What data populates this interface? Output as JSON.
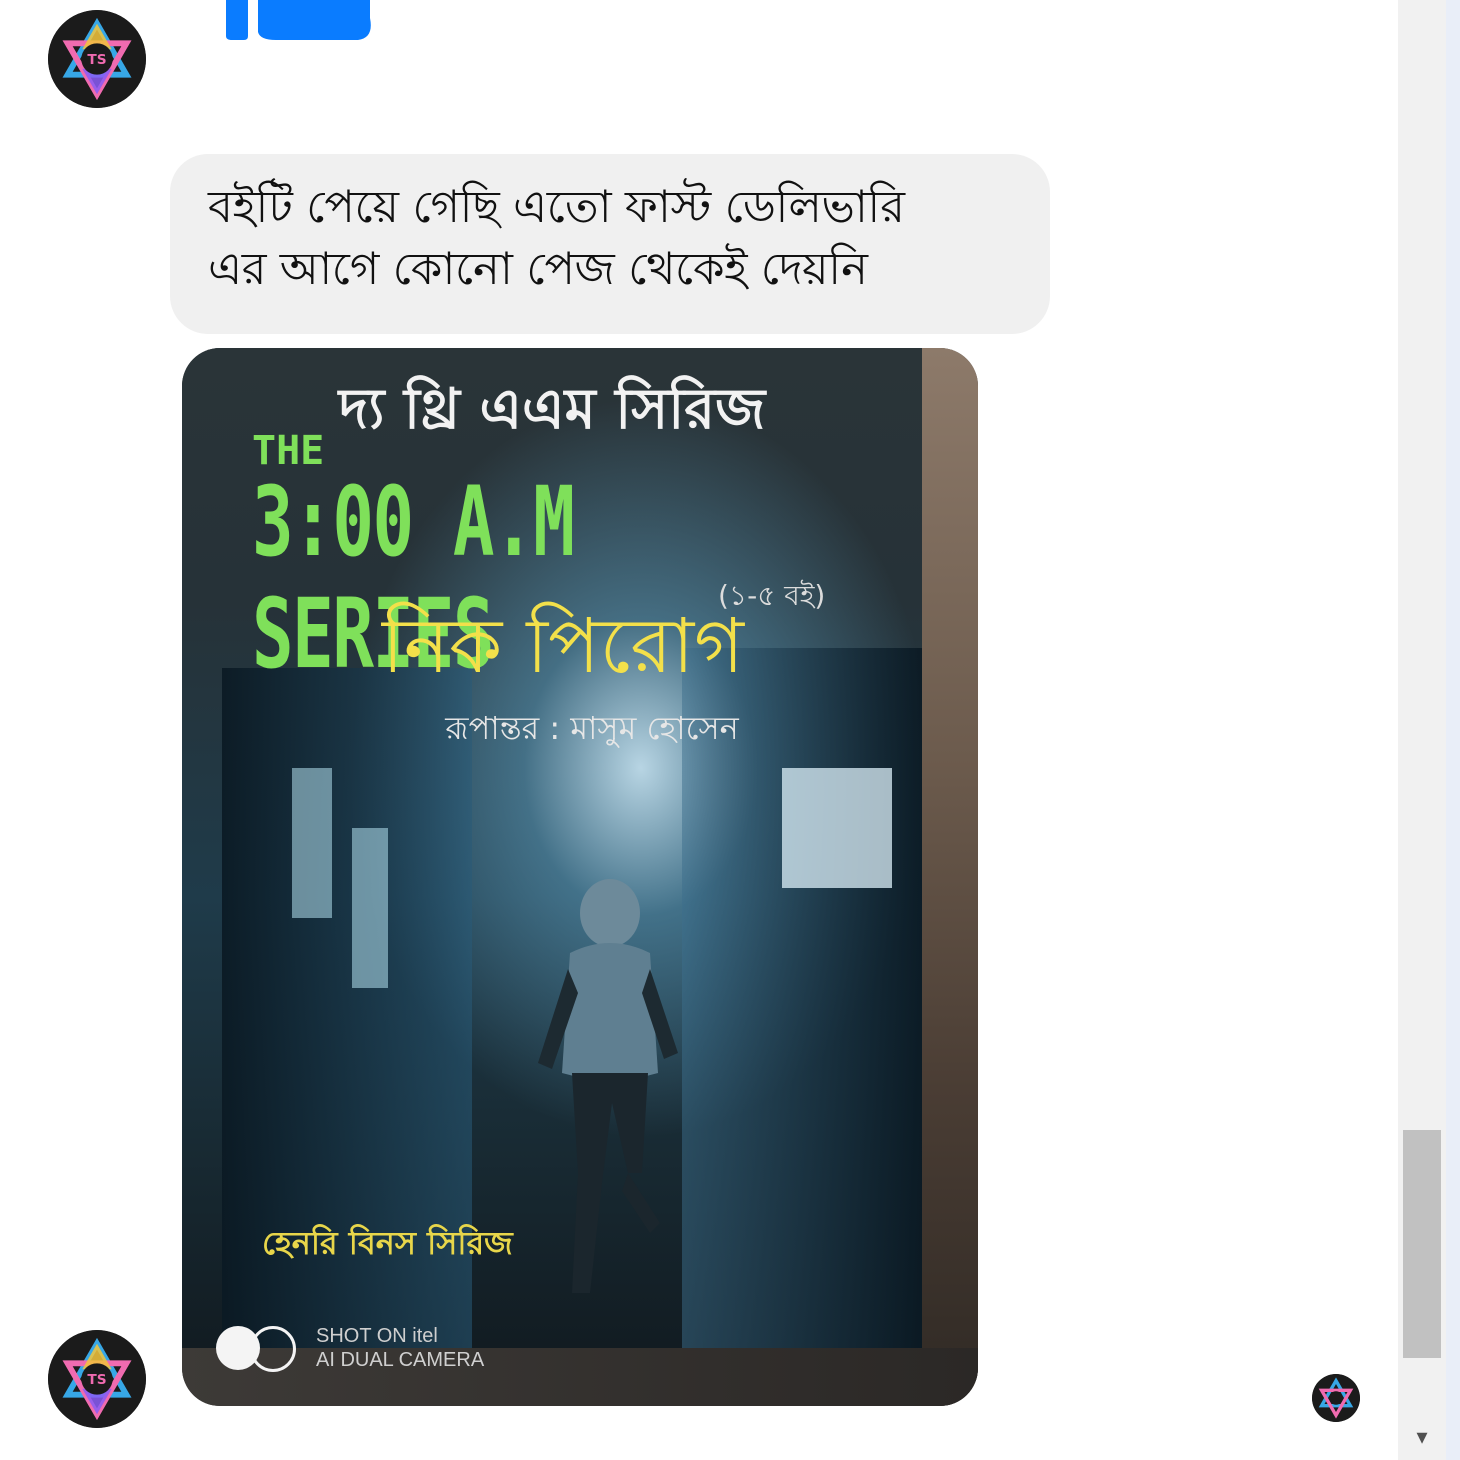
{
  "conversation": {
    "message_text": "বইটি পেয়ে গেছি এতো ফাস্ট ডেলিভারি এর আগে কোনো পেজ থেকেই দেয়নি",
    "message_lines": [
      "বইটি পেয়ে গেছি এতো ফাস্ট ডেলিভারি",
      "এর আগে কোনো পেজ থেকেই দেয়নি"
    ],
    "sender_avatar_icon": "ts-star-logo-icon",
    "top_like_icon": "thumbs-up-icon",
    "seen_indicator_icon": "ts-star-logo-icon"
  },
  "photo": {
    "cover": {
      "bangla_title": "দ্য থ্রি এএম সিরিজ",
      "the": "THE",
      "series_title": "3:00 A.M SERIES",
      "book_count": "(১-৫ বই)",
      "author": "নিক পিরোগ",
      "translator": "রূপান্তর : মাসুম হোসেন",
      "sub_series": "হেনরি বিনস সিরিজ"
    },
    "watermark": {
      "line1": "SHOT ON itel",
      "line2": "AI DUAL CAMERA"
    }
  },
  "scrollbar": {
    "position_fraction": 0.85,
    "down_arrow": "▾"
  },
  "colors": {
    "bubble_bg": "#f0f0f0",
    "like_blue": "#0a7cff",
    "series_green": "#7fe05a",
    "author_yellow": "#f3e04a"
  }
}
